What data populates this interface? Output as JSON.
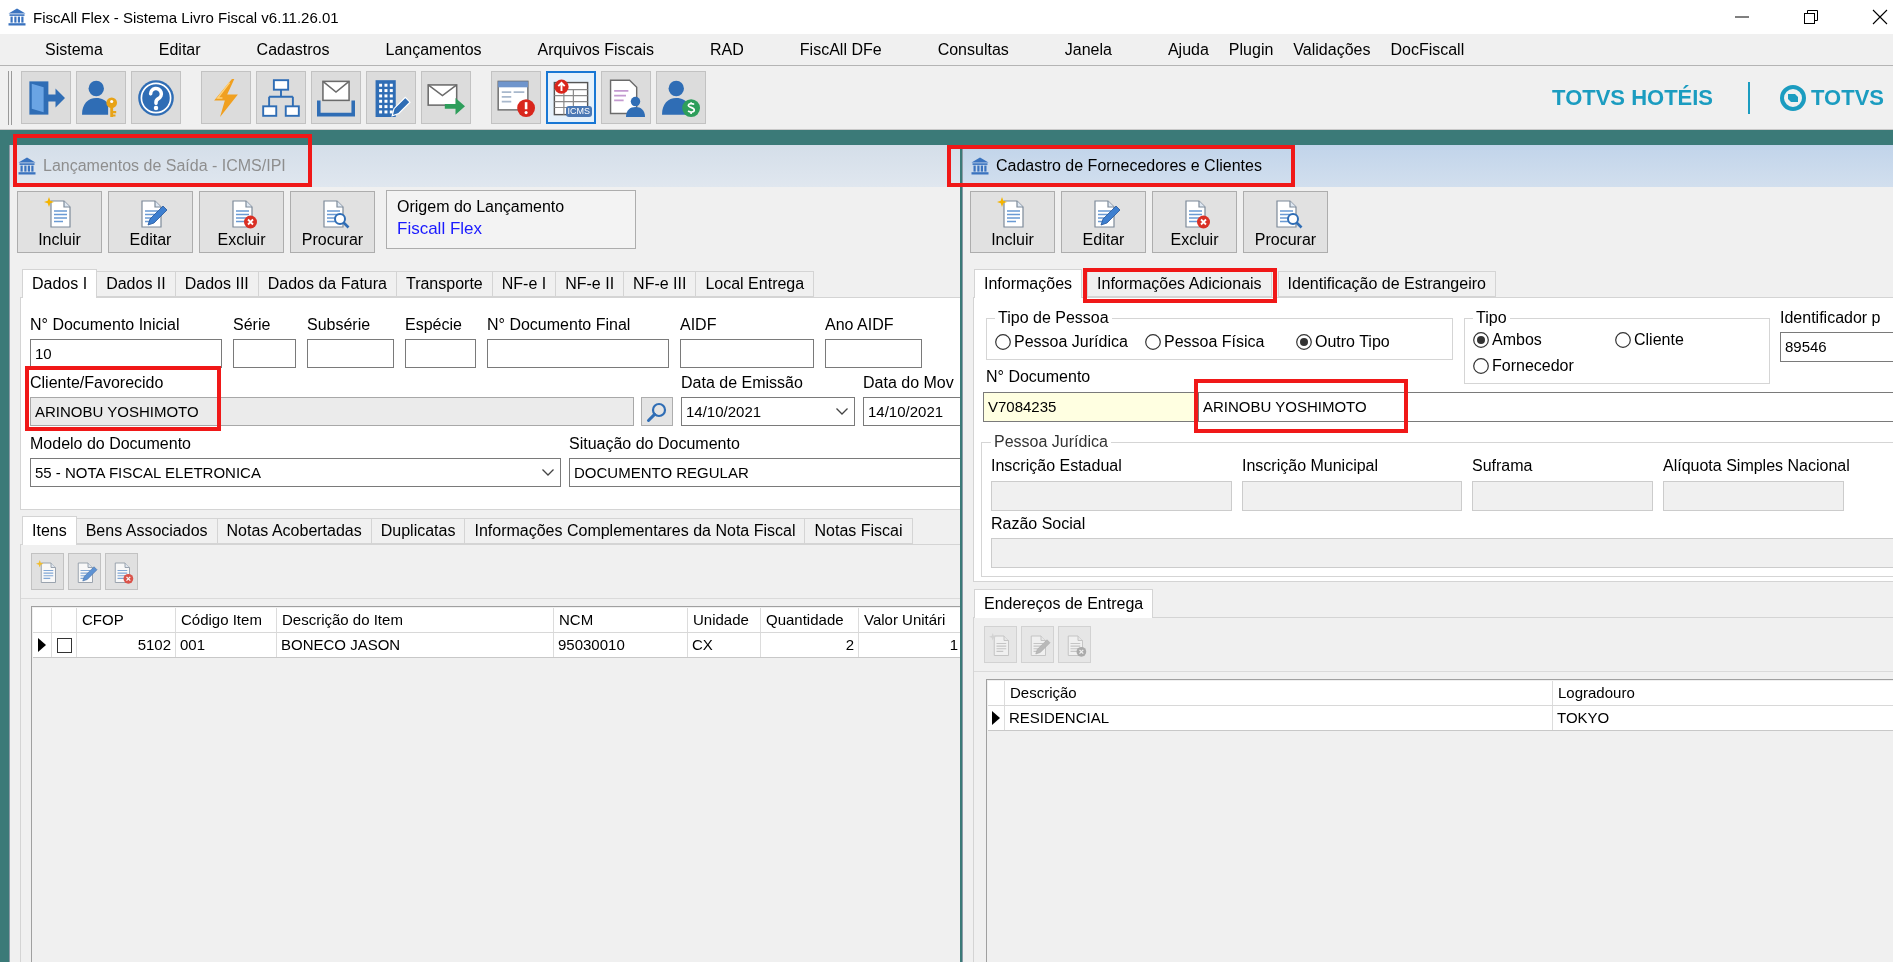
{
  "window": {
    "title": "FiscAll Flex - Sistema Livro Fiscal v6.11.26.01"
  },
  "menu": [
    "Sistema",
    "Editar",
    "Cadastros",
    "Lançamentos",
    "Arquivos Fiscais",
    "RAD",
    "FiscAll DFe",
    "Consultas",
    "Janela",
    "Ajuda",
    "Plugin",
    "Validações",
    "DocFiscall"
  ],
  "toolbar": {
    "groups": [
      [
        {
          "kind": "exit",
          "selected": false
        },
        {
          "kind": "user-key",
          "selected": false
        },
        {
          "kind": "help",
          "selected": false
        }
      ],
      [
        {
          "kind": "lightning",
          "selected": false
        },
        {
          "kind": "org-chart",
          "selected": false
        },
        {
          "kind": "inbox",
          "selected": false
        },
        {
          "kind": "building-pen",
          "selected": false
        },
        {
          "kind": "send-mail",
          "selected": false
        }
      ],
      [
        {
          "kind": "window-alert",
          "selected": false
        },
        {
          "kind": "table-upload",
          "selected": true,
          "badge": "ICMS"
        },
        {
          "kind": "document-person",
          "selected": false
        },
        {
          "kind": "person-dollar",
          "selected": false
        }
      ]
    ],
    "brand": {
      "name": "TOTVS HOTÉIS",
      "logo_text": "TOTVS"
    }
  },
  "output_window": {
    "title": "Lançamentos de Saída - ICMS/IPI",
    "active": false,
    "highlighted": true,
    "actions": [
      {
        "kind": "new",
        "label": "Incluir"
      },
      {
        "kind": "edit",
        "label": "Editar"
      },
      {
        "kind": "delete",
        "label": "Excluir"
      },
      {
        "kind": "search",
        "label": "Procurar"
      }
    ],
    "origin": {
      "label": "Origem do Lançamento",
      "value": "Fiscall Flex"
    },
    "tabs": [
      {
        "label": "Dados I",
        "selected": true
      },
      {
        "label": "Dados II",
        "selected": false
      },
      {
        "label": "Dados III",
        "selected": false
      },
      {
        "label": "Dados da Fatura",
        "selected": false
      },
      {
        "label": "Transporte",
        "selected": false
      },
      {
        "label": "NF-e I",
        "selected": false
      },
      {
        "label": "NF-e II",
        "selected": false
      },
      {
        "label": "NF-e III",
        "selected": false
      },
      {
        "label": "Local Entrega",
        "selected": false
      }
    ],
    "field_rows": [
      [
        {
          "kind": "text",
          "label": "N° Documento Inicial",
          "value": "10",
          "highlighted": false
        },
        {
          "kind": "text",
          "label": "Série",
          "highlighted": false
        },
        {
          "kind": "text",
          "label": "Subsérie",
          "highlighted": false
        },
        {
          "kind": "text",
          "label": "Espécie",
          "highlighted": false
        },
        {
          "kind": "text",
          "label": "N° Documento Final",
          "highlighted": false
        },
        {
          "kind": "text",
          "label": "AIDF",
          "highlighted": false
        },
        {
          "kind": "text",
          "label": "Ano AIDF",
          "highlighted": false
        }
      ],
      [
        {
          "kind": "lookup",
          "label": "Cliente/Favorecido",
          "value": "ARINOBU YOSHIMOTO",
          "highlighted": true
        },
        {
          "kind": "combo",
          "label": "Data de Emissão",
          "value": "14/10/2021",
          "highlighted": false
        },
        {
          "kind": "text",
          "label": "Data do Mov",
          "value": "14/10/2021",
          "highlighted": false
        }
      ],
      [
        {
          "kind": "combo",
          "label": "Modelo do Documento",
          "value": "55 - NOTA FISCAL ELETRONICA",
          "highlighted": false
        },
        {
          "kind": "text",
          "label": "Situação do Documento",
          "value": "DOCUMENTO REGULAR",
          "highlighted": false
        }
      ]
    ],
    "item_tabs": [
      {
        "label": "Itens",
        "selected": true
      },
      {
        "label": "Bens Associados",
        "selected": false
      },
      {
        "label": "Notas Acobertadas",
        "selected": false
      },
      {
        "label": "Duplicatas",
        "selected": false
      },
      {
        "label": "Informações Complementares da Nota Fiscal",
        "selected": false
      },
      {
        "label": "Notas Fiscai",
        "selected": false
      }
    ],
    "item_toolbar": [
      {
        "kind": "new",
        "disabled": false
      },
      {
        "kind": "edit",
        "disabled": false
      },
      {
        "kind": "delete",
        "disabled": false
      }
    ],
    "items_table": {
      "columns": [
        "CFOP",
        "Código Item",
        "Descrição do Item",
        "NCM",
        "Unidade",
        "Quantidade",
        "Valor Unitári"
      ],
      "rows": [
        {
          "current": true,
          "checked": false,
          "cells": [
            "5102",
            "001",
            "BONECO JASON",
            "95030010",
            "CX",
            "2",
            "1"
          ]
        }
      ]
    }
  },
  "partner_window": {
    "title": "Cadastro de Fornecedores e Clientes",
    "active": true,
    "highlighted": true,
    "actions": [
      {
        "kind": "new",
        "label": "Incluir"
      },
      {
        "kind": "edit",
        "label": "Editar"
      },
      {
        "kind": "delete",
        "label": "Excluir"
      },
      {
        "kind": "search",
        "label": "Procurar"
      }
    ],
    "tabs": [
      {
        "label": "Informações",
        "selected": true,
        "highlighted": false
      },
      {
        "label": "Informações Adicionais",
        "selected": false,
        "highlighted": true
      },
      {
        "label": "Identificação de Estrangeiro",
        "selected": false,
        "highlighted": false
      }
    ],
    "person_type": {
      "label": "Tipo de Pessoa",
      "options": [
        {
          "label": "Pessoa Jurídica",
          "selected": false
        },
        {
          "label": "Pessoa Física",
          "selected": false
        },
        {
          "label": "Outro Tipo",
          "selected": true
        }
      ]
    },
    "partner_type": {
      "label": "Tipo",
      "options": [
        {
          "label": "Ambos",
          "selected": true
        },
        {
          "label": "Cliente",
          "selected": false
        },
        {
          "label": "Fornecedor",
          "selected": false
        }
      ]
    },
    "identifier": {
      "label": "Identificador p",
      "value": "89546"
    },
    "document": {
      "label": "N° Documento",
      "fields": [
        {
          "kind": "key",
          "value": "V7084235",
          "highlighted": false
        },
        {
          "kind": "text",
          "value": "ARINOBU YOSHIMOTO",
          "highlighted": true
        }
      ]
    },
    "company": {
      "label": "Pessoa Jurídica",
      "fields": [
        {
          "label": "Inscrição Estadual",
          "disabled": true
        },
        {
          "label": "Inscrição Municipal",
          "disabled": true
        },
        {
          "label": "Suframa",
          "disabled": true
        },
        {
          "label": "Alíquota Simples Nacional",
          "disabled": true
        }
      ],
      "corporate_name": {
        "label": "Razão Social",
        "disabled": true
      }
    },
    "address_tabs": [
      {
        "label": "Endereços de Entrega",
        "selected": true
      }
    ],
    "address_toolbar": [
      {
        "kind": "new",
        "disabled": true
      },
      {
        "kind": "edit",
        "disabled": true
      },
      {
        "kind": "delete",
        "disabled": true
      }
    ],
    "address_table": {
      "columns": [
        "Descrição",
        "Logradouro"
      ],
      "rows": [
        {
          "current": true,
          "cells": [
            "RESIDENCIAL",
            "TOKYO"
          ]
        }
      ]
    }
  }
}
